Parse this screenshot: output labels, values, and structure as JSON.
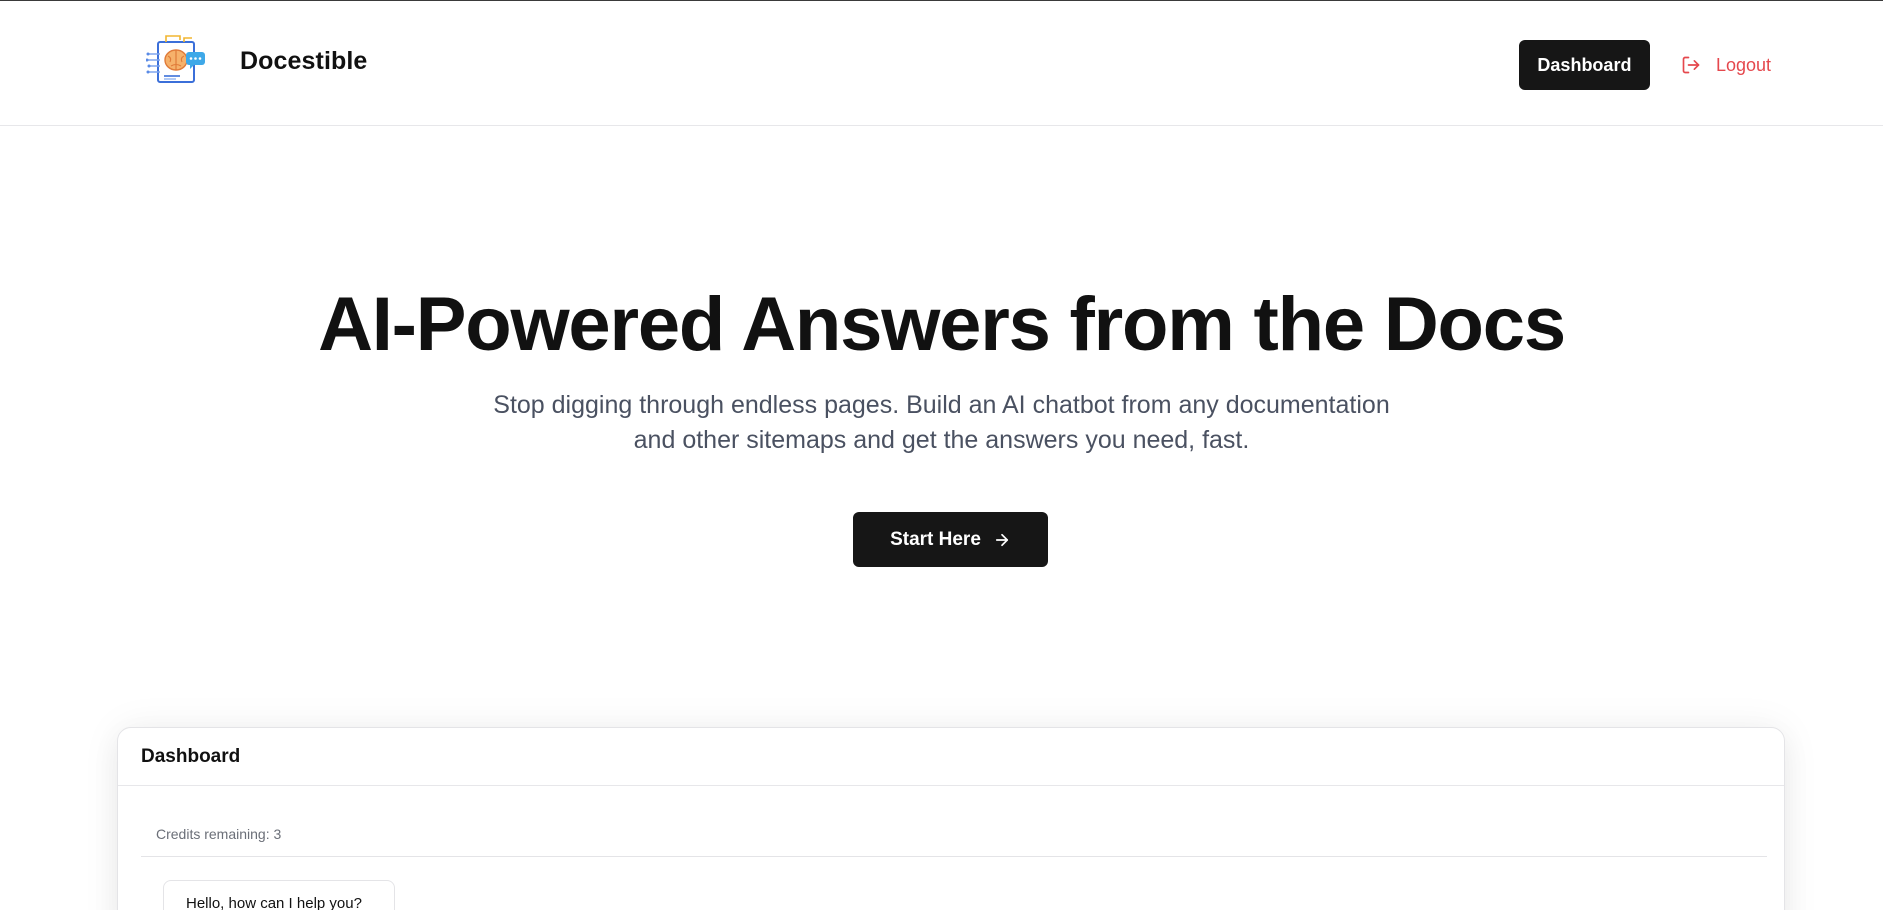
{
  "brand": {
    "name": "Docestible",
    "logo_icon": "brain-chat-document-icon"
  },
  "nav": {
    "dashboard_label": "Dashboard",
    "logout_label": "Logout",
    "logout_icon": "logout-arrow-icon",
    "logout_color": "#e5484d"
  },
  "hero": {
    "title": "AI-Powered Answers from the Docs",
    "subtitle": "Stop digging through endless pages. Build an AI chatbot from any documentation and other sitemaps and get the answers you need, fast.",
    "cta_label": "Start Here",
    "cta_icon": "arrow-right-icon"
  },
  "dashboard_card": {
    "title": "Dashboard",
    "credits_text": "Credits remaining: 3",
    "chat_message": "Hello, how can I help you?"
  },
  "colors": {
    "primary_button": "#161616",
    "subtitle_text": "#4a5161",
    "danger": "#e5484d"
  }
}
